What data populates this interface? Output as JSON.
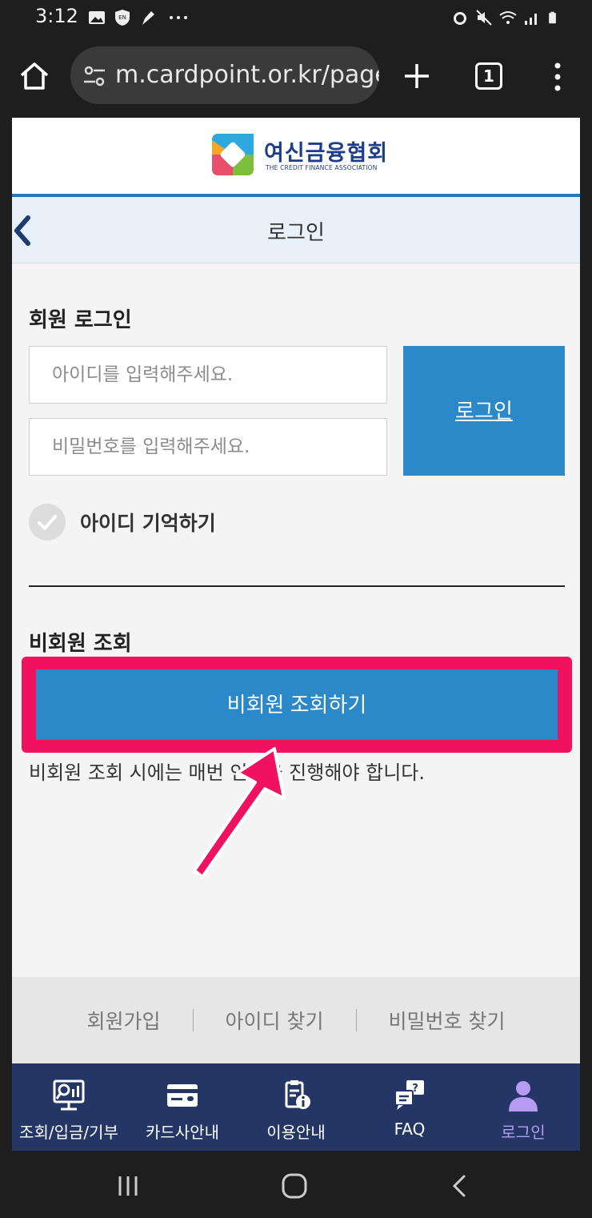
{
  "status": {
    "time": "3:12",
    "left_icons": [
      "image-icon",
      "shield-icon",
      "pen-icon",
      "more-dots-icon"
    ],
    "right_icons": [
      "alarm-icon",
      "mute-icon",
      "wifi-icon",
      "signal-icon",
      "battery-icon"
    ]
  },
  "browser": {
    "url": "m.cardpoint.or.kr/page",
    "tab_count": "1"
  },
  "header": {
    "logo_title": "여신금융협회",
    "logo_subtitle": "THE CREDIT FINANCE ASSOCIATION",
    "page_title": "로그인"
  },
  "member": {
    "section_title": "회원 로그인",
    "id_placeholder": "아이디를 입력해주세요.",
    "pw_placeholder": "비밀번호를 입력해주세요.",
    "login_label": "로그인",
    "remember_label": "아이디 기억하기"
  },
  "guest": {
    "section_title": "비회원 조회",
    "button_label": "비회원 조회하기",
    "note": "비회원 조회 시에는 매번 인증을 진행해야 합니다."
  },
  "footer": {
    "links": [
      "회원가입",
      "아이디 찾기",
      "비밀번호 찾기"
    ]
  },
  "bottom_nav": {
    "items": [
      {
        "label": "조회/입금/기부",
        "icon": "search-chart-icon"
      },
      {
        "label": "카드사안내",
        "icon": "card-icon"
      },
      {
        "label": "이용안내",
        "icon": "info-clipboard-icon"
      },
      {
        "label": "FAQ",
        "icon": "faq-icon"
      },
      {
        "label": "로그인",
        "icon": "user-icon"
      }
    ]
  },
  "colors": {
    "accent_blue": "#2b88c9",
    "highlight_pink": "#f0125f",
    "nav_bg": "#243666",
    "nav_active": "#b79af2"
  }
}
